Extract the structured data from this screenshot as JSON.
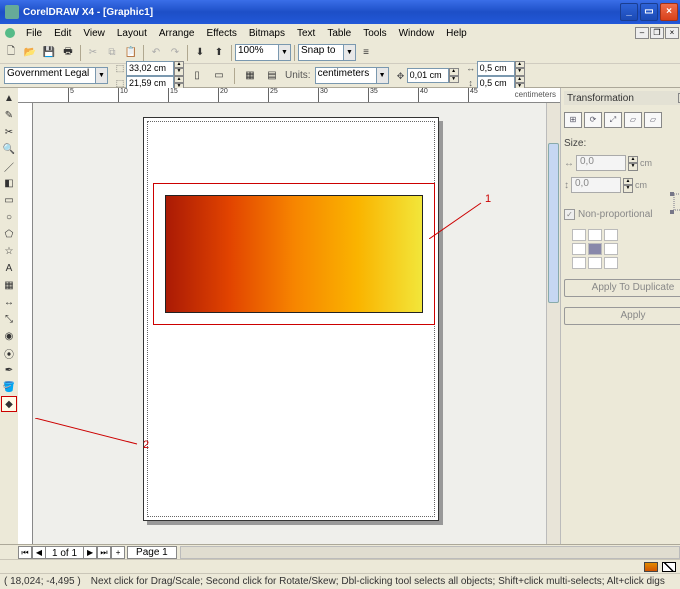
{
  "title": "CorelDRAW X4 - [Graphic1]",
  "menu": [
    "File",
    "Edit",
    "View",
    "Layout",
    "Arrange",
    "Effects",
    "Bitmaps",
    "Text",
    "Table",
    "Tools",
    "Window",
    "Help"
  ],
  "toolbar1": {
    "zoom": "100%",
    "snapto": "Snap to"
  },
  "propbar": {
    "paper": "Government Legal",
    "width": "33,02 cm",
    "height": "21,59 cm",
    "units_label": "Units:",
    "units": "centimeters",
    "nudge": "0,01 cm",
    "dup_x": "0,5 cm",
    "dup_y": "0,5 cm"
  },
  "ruler_unit": "centimeters",
  "ruler_ticks": [
    "5",
    "10",
    "15",
    "20",
    "25",
    "30",
    "35",
    "40",
    "45"
  ],
  "panel": {
    "title": "Transformation",
    "size_label": "Size:",
    "w": "0,0",
    "h": "0,0",
    "unit": "cm",
    "nonprop": "Non-proportional",
    "apply_dup": "Apply To Duplicate",
    "apply": "Apply"
  },
  "pagenav": {
    "count": "1 of 1",
    "page": "Page 1"
  },
  "status": {
    "coords": "( 18,024; -4,495 )",
    "hint": "Next click for Drag/Scale; Second click for Rotate/Skew; Dbl-clicking tool selects all objects; Shift+click multi-selects; Alt+click digs"
  },
  "annot": {
    "one": "1",
    "two": "2"
  },
  "palette": [
    "#000000",
    "#ffffff",
    "#bfbfbf",
    "#7f7f7f",
    "#3f3f3f",
    "#1f1f1f",
    "#5f5f5f",
    "#9f9f9f",
    "#d0d0d0",
    "#4a2a18",
    "#b54400",
    "#e86e00",
    "#f7a200",
    "#f2e000",
    "#7fa500",
    "#2f7f2a",
    "#1f6a8f",
    "#2a3aa0",
    "#5a2a9f",
    "#b52a8f"
  ]
}
